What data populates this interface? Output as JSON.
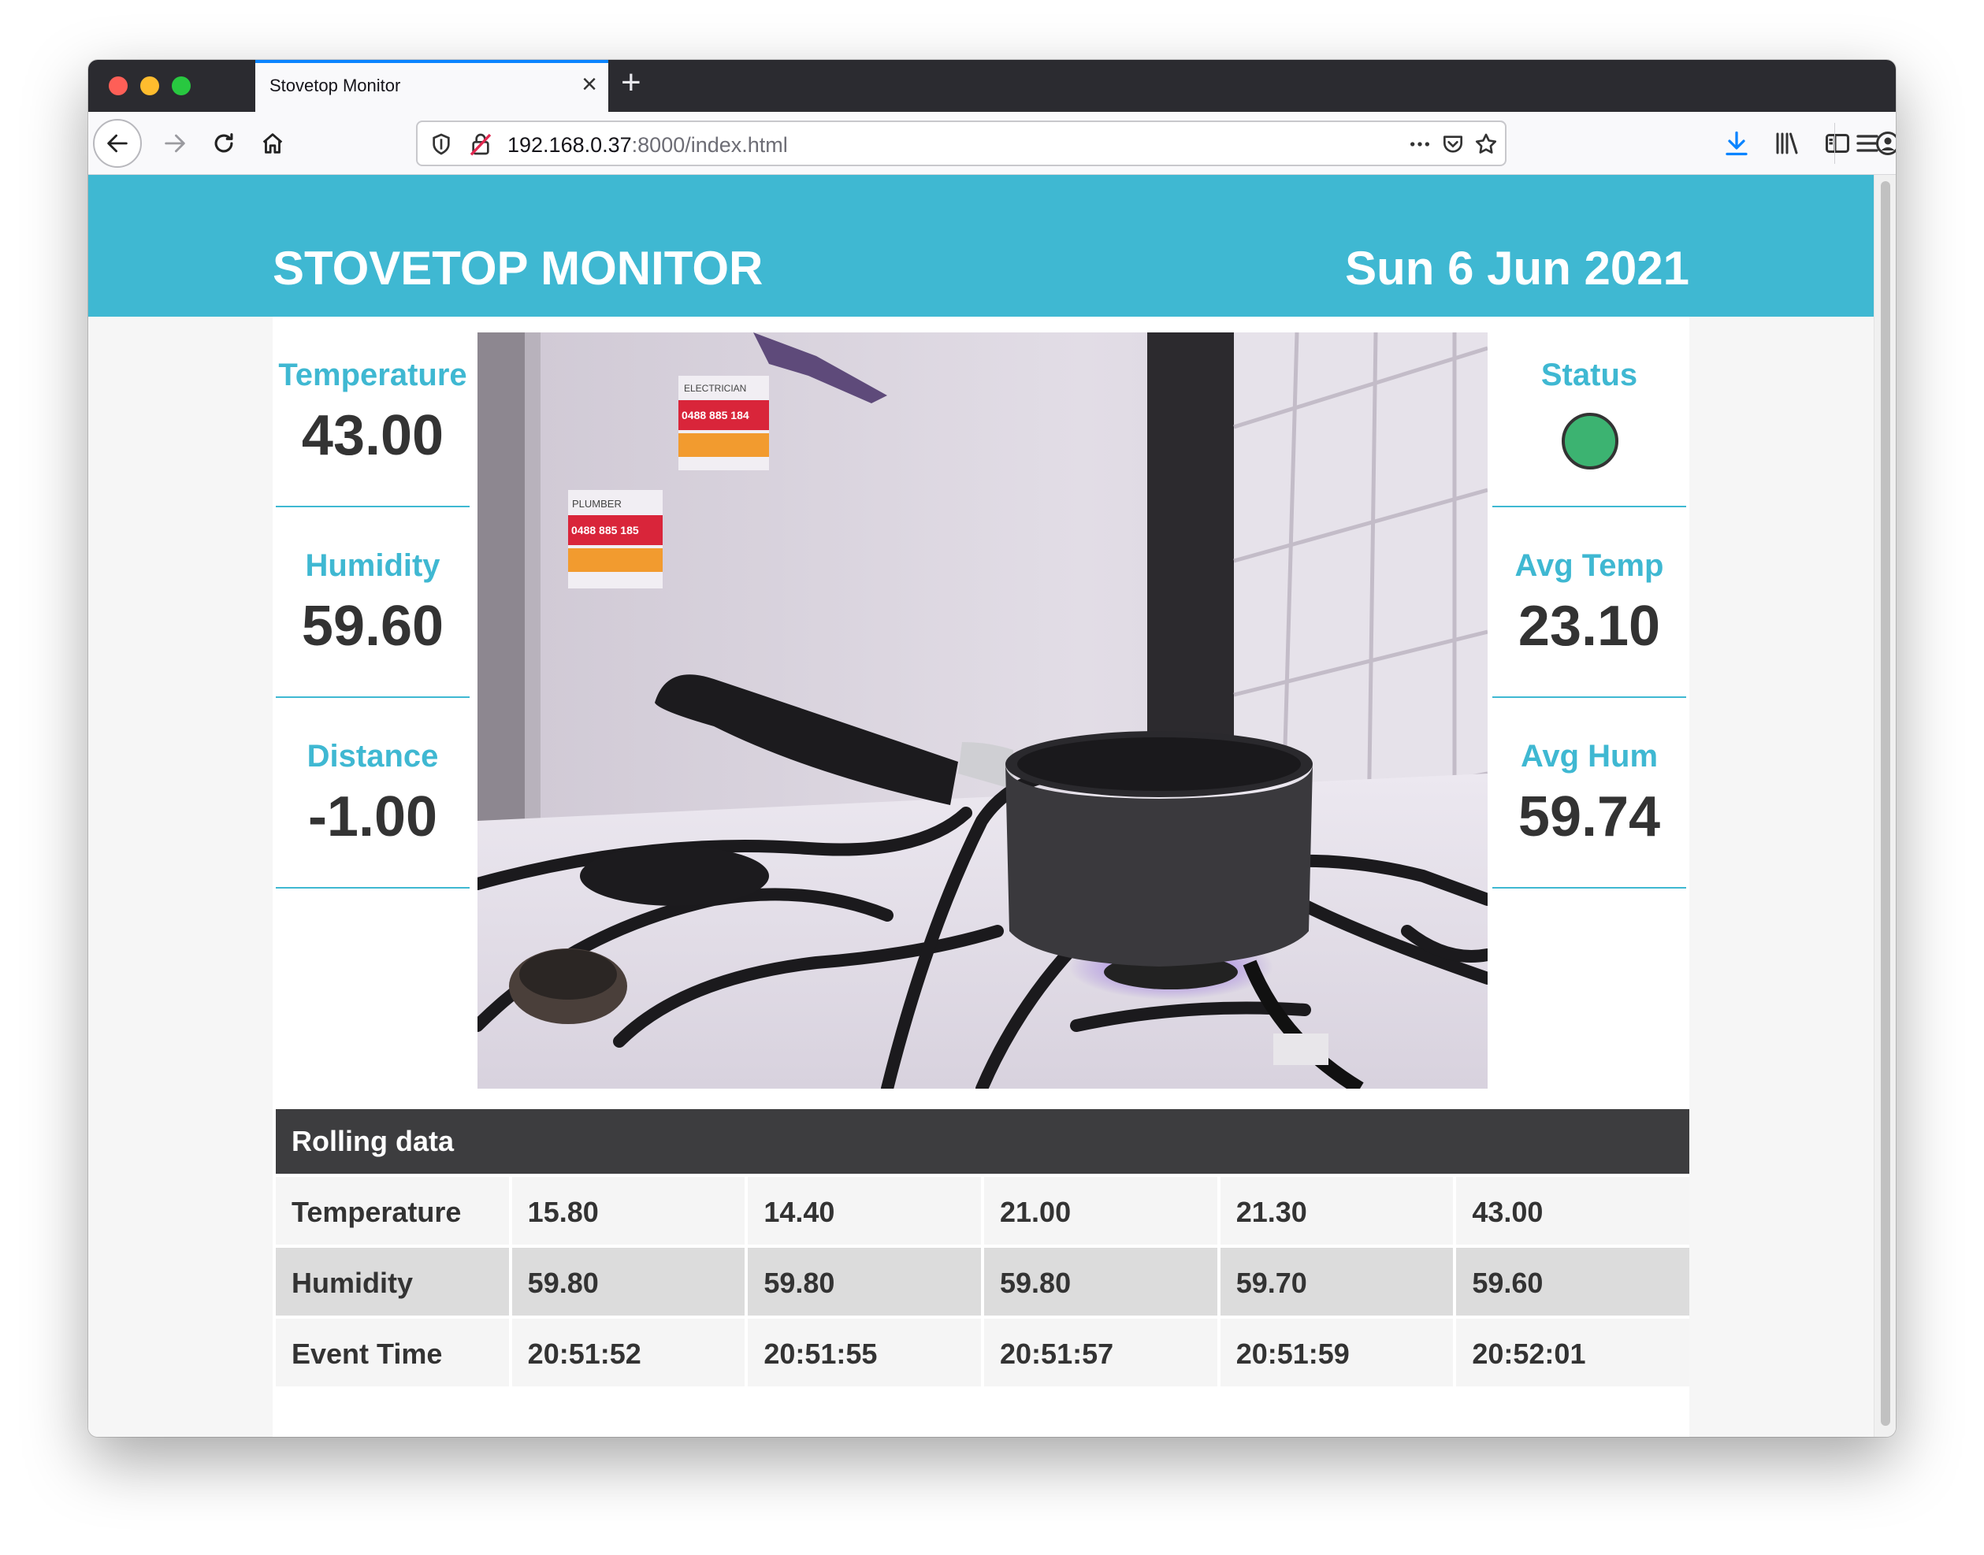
{
  "browser": {
    "tab_title": "Stovetop Monitor",
    "url_host": "192.168.0.37",
    "url_path": ":8000/index.html"
  },
  "header": {
    "title": "STOVETOP MONITOR",
    "date": "Sun 6 Jun 2021"
  },
  "stats_left": [
    {
      "label": "Temperature",
      "value": "43.00"
    },
    {
      "label": "Humidity",
      "value": "59.60"
    },
    {
      "label": "Distance",
      "value": "-1.00"
    }
  ],
  "stats_right": {
    "status_label": "Status",
    "status_color": "#3cb371",
    "avg_temp_label": "Avg Temp",
    "avg_temp_value": "23.10",
    "avg_hum_label": "Avg Hum",
    "avg_hum_value": "59.74"
  },
  "camera": {
    "sticker1_title": "ELECTRICIAN",
    "sticker1_phone": "0488 885 184",
    "sticker2_title": "PLUMBER",
    "sticker2_phone": "0488 885 185"
  },
  "rolling": {
    "title": "Rolling data",
    "rows": [
      {
        "label": "Temperature",
        "values": [
          "15.80",
          "14.40",
          "21.00",
          "21.30",
          "43.00"
        ]
      },
      {
        "label": "Humidity",
        "values": [
          "59.80",
          "59.80",
          "59.80",
          "59.70",
          "59.60"
        ]
      },
      {
        "label": "Event Time",
        "values": [
          "20:51:52",
          "20:51:55",
          "20:51:57",
          "20:51:59",
          "20:52:01"
        ]
      }
    ]
  },
  "colors": {
    "accent": "#3fb8d2",
    "table_header": "#3d3d3f"
  }
}
